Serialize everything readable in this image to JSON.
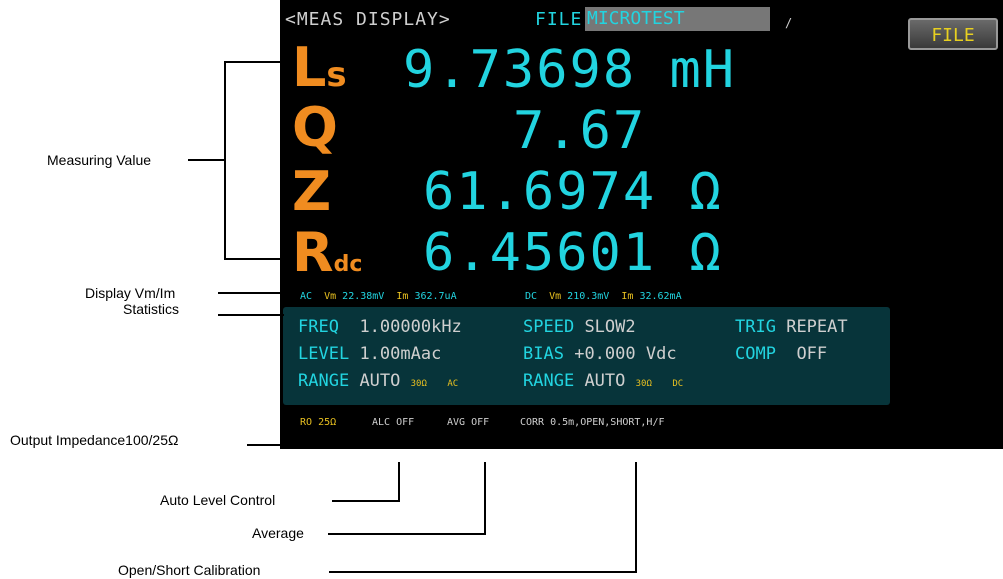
{
  "header": {
    "screen_title": "<MEAS DISPLAY>",
    "file_label": "FILE",
    "file_name": "MICROTEST",
    "separator": "/",
    "file_button": "FILE"
  },
  "measurements": [
    {
      "param": "L",
      "sub": "s",
      "value": "9.73698 mH"
    },
    {
      "param": "Q",
      "sub": "",
      "value": "7.67"
    },
    {
      "param": "Z",
      "sub": "",
      "value": "61.6974  Ω"
    },
    {
      "param": "R",
      "sub": "dc",
      "value": "6.45601  Ω"
    }
  ],
  "vmim": {
    "ac_label": "AC",
    "ac_vm_label": "Vm",
    "ac_vm": "22.38mV",
    "ac_im_label": "Im",
    "ac_im": "362.7uA",
    "dc_label": "DC",
    "dc_vm_label": "Vm",
    "dc_vm": "210.3mV",
    "dc_im_label": "Im",
    "dc_im": "32.62mA"
  },
  "setup": {
    "freq_label": "FREQ",
    "freq": "1.00000kHz",
    "speed_label": "SPEED",
    "speed": "SLOW2",
    "trig_label": "TRIG",
    "trig": "REPEAT",
    "level_label": "LEVEL",
    "level": "1.00mAac",
    "bias_label": "BIAS",
    "bias": "+0.000 Vdc",
    "comp_label": "COMP",
    "comp": "OFF",
    "range_label": "RANGE",
    "range_ac": "AUTO",
    "range_ac_ohm": "30Ω",
    "range_ac_tag": "AC",
    "range2_label": "RANGE",
    "range_dc": "AUTO",
    "range_dc_ohm": "30Ω",
    "range_dc_tag": "DC"
  },
  "status": {
    "ro_label": "RO",
    "ro": "25Ω",
    "alc": "ALC OFF",
    "avg": "AVG OFF",
    "corr": "CORR 0.5m,OPEN,SHORT,H/F"
  },
  "callouts": {
    "measuring_value": "Measuring Value",
    "display_vmim": "Display Vm/Im",
    "statistics": "Statistics",
    "output_impedance": "Output Impedance100/25Ω",
    "auto_level_control": "Auto Level Control",
    "average": "Average",
    "open_short_calibration": "Open/Short Calibration"
  },
  "colors": {
    "param_orange": "#f08c20",
    "value_cyan": "#22d4e0",
    "setup_panel": "#07343a",
    "screen_bg": "#000000"
  }
}
